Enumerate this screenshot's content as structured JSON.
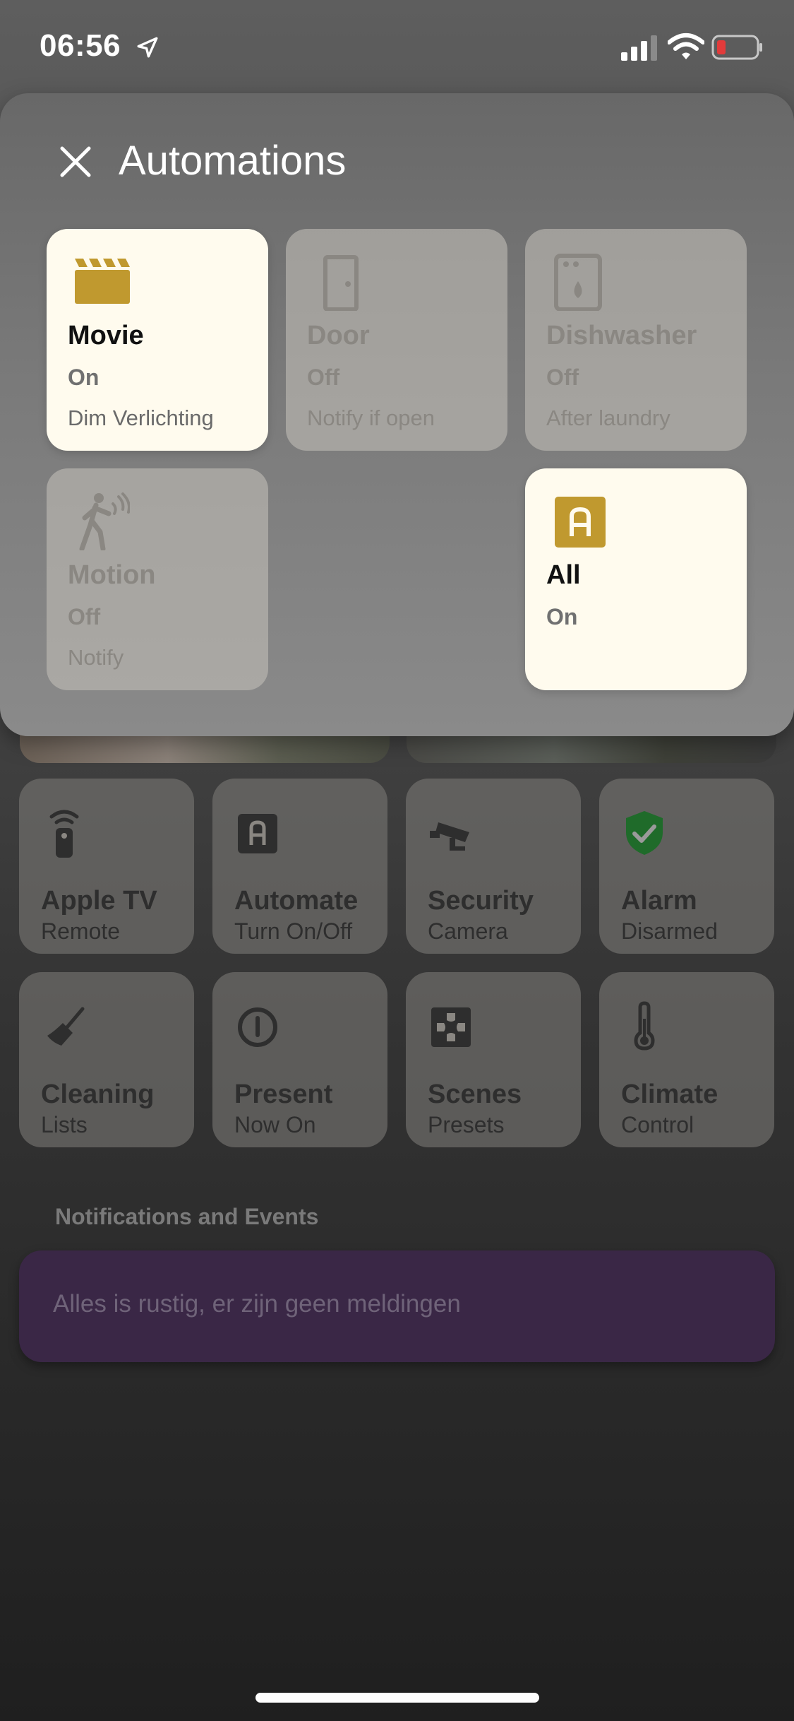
{
  "status_bar": {
    "time": "06:56"
  },
  "sheet": {
    "title": "Automations",
    "cards": [
      {
        "name": "Movie",
        "state": "On",
        "description": "Dim Verlichting",
        "active": true,
        "icon": "clapperboard-icon"
      },
      {
        "name": "Door",
        "state": "Off",
        "description": "Notify if open",
        "active": false,
        "icon": "door-icon"
      },
      {
        "name": "Dishwasher",
        "state": "Off",
        "description": "After laundry",
        "active": false,
        "icon": "dishwasher-icon"
      },
      {
        "name": "Motion",
        "state": "Off",
        "description": "Notify",
        "active": false,
        "icon": "motion-sensor-icon"
      },
      {
        "name": "All",
        "state": "On",
        "description": "",
        "active": true,
        "icon": "automation-a-icon"
      }
    ]
  },
  "home": {
    "tiles": [
      {
        "title": "Apple TV",
        "subtitle": "Remote",
        "icon": "remote-icon"
      },
      {
        "title": "Automate",
        "subtitle": "Turn On/Off",
        "icon": "automation-a-icon"
      },
      {
        "title": "Security",
        "subtitle": "Camera",
        "icon": "security-camera-icon"
      },
      {
        "title": "Alarm",
        "subtitle": "Disarmed",
        "icon": "shield-check-icon"
      },
      {
        "title": "Cleaning",
        "subtitle": "Lists",
        "icon": "broom-icon"
      },
      {
        "title": "Present",
        "subtitle": "Now On",
        "icon": "power-icon"
      },
      {
        "title": "Scenes",
        "subtitle": "Presets",
        "icon": "scenes-icon"
      },
      {
        "title": "Climate",
        "subtitle": "Control",
        "icon": "thermometer-icon"
      }
    ],
    "notifications": {
      "title": "Notifications and Events",
      "empty_message": "Alles is rustig, er zijn geen meldingen"
    }
  },
  "colors": {
    "accent_gold": "#c0992f",
    "active_card": "#fffbee",
    "alarm_green": "#1f6b2a",
    "notification_purple": "#3a2746"
  }
}
